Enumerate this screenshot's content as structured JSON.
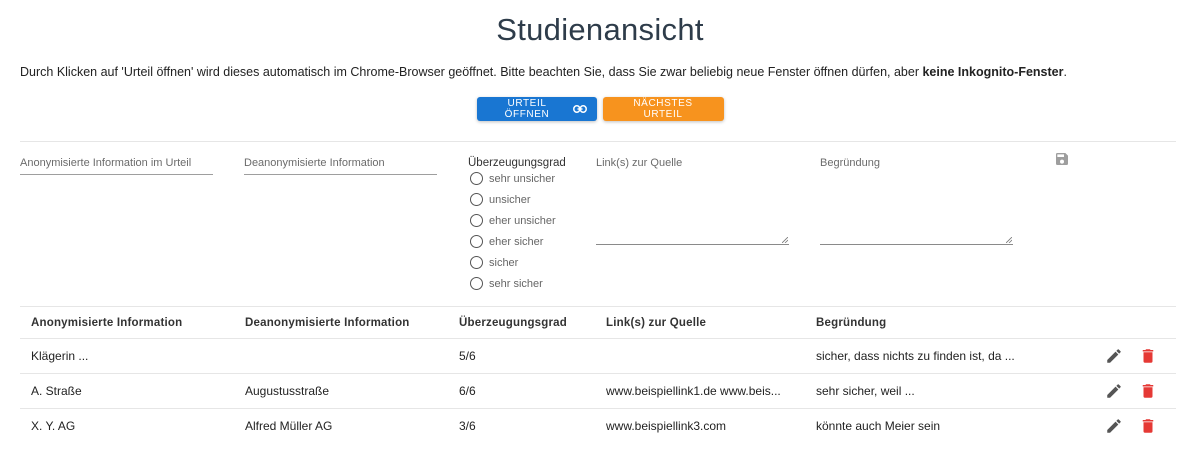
{
  "page": {
    "title": "Studienansicht",
    "intro_text": "Durch Klicken auf 'Urteil öffnen' wird dieses automatisch im Chrome-Browser geöffnet. Bitte beachten Sie, dass Sie zwar beliebig neue Fenster öffnen dürfen, aber ",
    "intro_bold": "keine Inkognito-Fenster",
    "intro_end": "."
  },
  "buttons": {
    "open_judgment": "URTEIL ÖFFNEN",
    "next_judgment": "NÄCHSTES URTEIL"
  },
  "colors": {
    "primary": "#1976d2",
    "accent": "#f7931e",
    "delete": "#e53935"
  },
  "form": {
    "anon_placeholder": "Anonymisierte Information im Urteil",
    "deanon_placeholder": "Deanonymisierte Information",
    "confidence_label": "Überzeugungsgrad",
    "confidence_options": [
      "sehr unsicher",
      "unsicher",
      "eher unsicher",
      "eher sicher",
      "sicher",
      "sehr sicher"
    ],
    "links_placeholder": "Link(s) zur Quelle",
    "reason_placeholder": "Begründung",
    "save_icon": "save-icon"
  },
  "table": {
    "headers": [
      "Anonymisierte Information",
      "Deanonymisierte Information",
      "Überzeugungsgrad",
      "Link(s) zur Quelle",
      "Begründung"
    ],
    "rows": [
      [
        "Klägerin ...",
        "",
        "5/6",
        "",
        "sicher, dass nichts zu finden ist, da ..."
      ],
      [
        "A. Straße",
        "Augustusstraße",
        "6/6",
        "www.beispiellink1.de www.beis...",
        "sehr sicher, weil ..."
      ],
      [
        "X. Y. AG",
        "Alfred Müller AG",
        "3/6",
        "www.beispiellink3.com",
        "könnte auch Meier sein"
      ]
    ],
    "row_actions": [
      "edit-icon",
      "delete-icon"
    ]
  }
}
